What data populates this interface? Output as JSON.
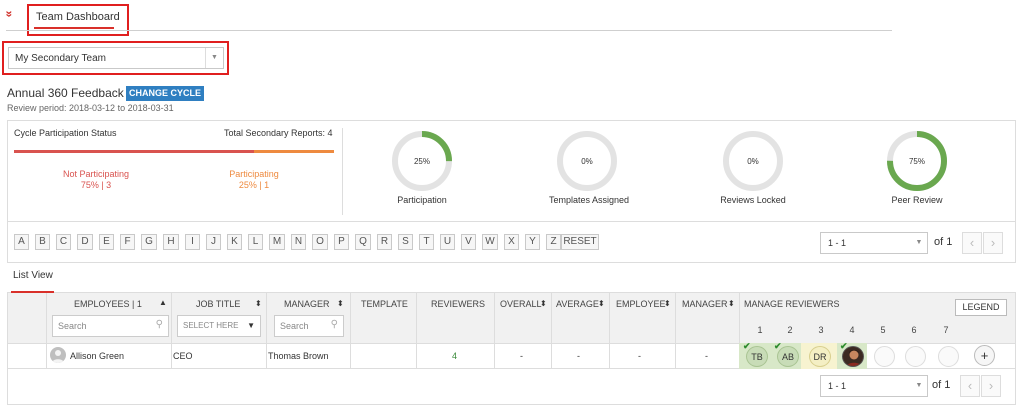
{
  "header": {
    "collapse_glyph": "»",
    "tab_label": "Team Dashboard"
  },
  "team_select": {
    "value": "My Secondary Team"
  },
  "cycle": {
    "title": "Annual 360 Feedback",
    "change_button": "CHANGE CYCLE",
    "review_period": "Review period: 2018-03-12 to 2018-03-31"
  },
  "participation": {
    "title": "Cycle Participation Status",
    "total_label": "Total Secondary Reports: 4",
    "not_participating_label": "Not Participating",
    "not_participating_value": "75% | 3",
    "participating_label": "Participating",
    "participating_value": "25% | 1",
    "colors": {
      "not_participating": "#d9534f",
      "participating": "#ee8a3f"
    },
    "not_participating_fraction": 0.75
  },
  "stats": [
    {
      "percent_text": "25%",
      "label": "Participation",
      "percent": 25
    },
    {
      "percent_text": "0%",
      "label": "Templates Assigned",
      "percent": 0
    },
    {
      "percent_text": "0%",
      "label": "Reviews Locked",
      "percent": 0
    },
    {
      "percent_text": "75%",
      "label": "Peer Review",
      "percent": 75
    }
  ],
  "stat_colors": {
    "ring": "#6aa84f",
    "track": "#e3e3e3"
  },
  "alphabet": [
    "A",
    "B",
    "C",
    "D",
    "E",
    "F",
    "G",
    "H",
    "I",
    "J",
    "K",
    "L",
    "M",
    "N",
    "O",
    "P",
    "Q",
    "R",
    "S",
    "T",
    "U",
    "V",
    "W",
    "X",
    "Y",
    "Z"
  ],
  "reset_label": "RESET",
  "pager": {
    "value": "1 - 1",
    "of_label": "of 1",
    "prev_glyph": "‹",
    "next_glyph": "›"
  },
  "list_view_label": "List View",
  "table": {
    "headers": {
      "employees": "EMPLOYEES | 1",
      "job_title": "JOB TITLE",
      "manager": "MANAGER",
      "template": "TEMPLATE",
      "reviewers": "REVIEWERS",
      "overall": "OVERALL",
      "average": "AVERAGE",
      "employee": "EMPLOYEE",
      "manager2": "MANAGER",
      "manage_reviewers": "MANAGE REVIEWERS"
    },
    "sort_glyphs": {
      "asc": "▲",
      "both": "⬍"
    },
    "filters": {
      "employees_placeholder": "Search",
      "job_title_placeholder": "SELECT HERE",
      "manager_placeholder": "Search"
    },
    "legend_label": "LEGEND",
    "reviewer_numbers": [
      "1",
      "2",
      "3",
      "4",
      "5",
      "6",
      "7"
    ],
    "rows": [
      {
        "employee": "Allison Green",
        "job_title": "CEO",
        "manager": "Thomas Brown",
        "template": "",
        "reviewers": "4",
        "overall": "-",
        "average": "-",
        "employee_score": "-",
        "manager_score": "-",
        "reviewer_chips": [
          {
            "initials": "TB",
            "checked": true,
            "bg": "#c8dcb7"
          },
          {
            "initials": "AB",
            "checked": true,
            "bg": "#c8dcb7"
          },
          {
            "initials": "DR",
            "checked": false,
            "bg": "#f4efc4"
          },
          {
            "initials": "",
            "checked": true,
            "bg": "#7a4a2e",
            "photo": true
          }
        ],
        "add_glyph": "+"
      }
    ]
  }
}
